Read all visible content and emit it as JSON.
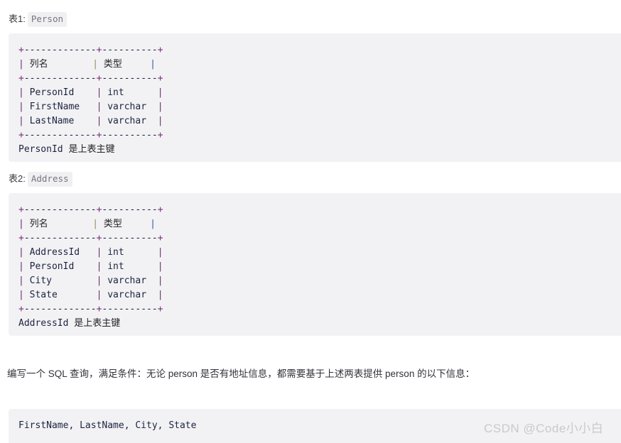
{
  "page": {
    "background": "#ffffff",
    "code_background": "#f2f2f4",
    "inline_code_background": "#f0f0f3"
  },
  "sections": [
    {
      "caption_label": "表1:",
      "caption_code": "Person",
      "code_lines": [
        "+-------------+----------+",
        "| 列名         | 类型      |",
        "+-------------+----------+",
        "| PersonId    | int      |",
        "| FirstName   | varchar  |",
        "| LastName    | varchar  |",
        "+-------------+----------+",
        "PersonId 是上表主键"
      ]
    },
    {
      "caption_label": "表2:",
      "caption_code": "Address",
      "code_lines": [
        "+-------------+----------+",
        "| 列名         | 类型      |",
        "+-------------+----------+",
        "| AddressId   | int      |",
        "| PersonId    | int      |",
        "| City        | varchar  |",
        "| State       | varchar  |",
        "+-------------+----------+",
        "AddressId 是上表主键"
      ]
    }
  ],
  "prose": {
    "question": "编写一个 SQL 查询，满足条件：无论 person 是否有地址信息，都需要基于上述两表提供 person 的以下信息："
  },
  "answer_block": {
    "code": "FirstName, LastName, City, State"
  },
  "watermark": {
    "text": "CSDN @Code小小白",
    "color": "#c9c9cf"
  }
}
